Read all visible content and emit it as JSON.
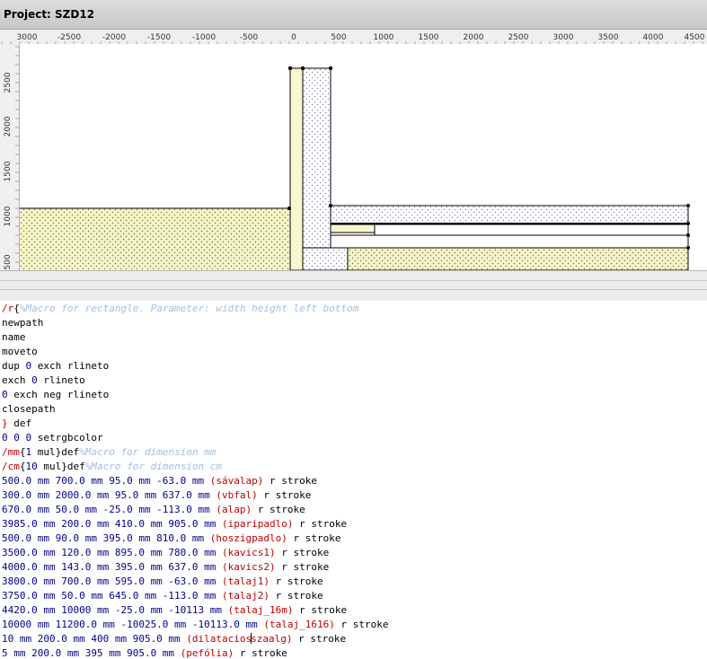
{
  "window": {
    "title": "Project: SZD12"
  },
  "ruler_top": {
    "labels": [
      "3000",
      "-2500",
      "-2000",
      "-1500",
      "-1000",
      "-500",
      "0",
      "500",
      "1000",
      "1500",
      "2000",
      "2500",
      "3000",
      "3500",
      "4000",
      "4500"
    ]
  },
  "ruler_left": {
    "labels": [
      "2500",
      "2000",
      "1500",
      "1000",
      "500"
    ]
  },
  "drawing": {
    "colors": {
      "soil_fill": "#f4f4c8",
      "soil_dots": "#6e7a30",
      "gravel_dots": "#6a6a9a",
      "outline": "#000000"
    }
  },
  "editor": {
    "lines": [
      [
        {
          "t": "/r",
          "c": "red"
        },
        {
          "t": "{",
          "c": "kw"
        },
        {
          "t": "%Macro for rectangle. Parameter: width height left bottom",
          "c": "cmt"
        }
      ],
      [
        {
          "t": "newpath",
          "c": "kw"
        }
      ],
      [
        {
          "t": "name",
          "c": "kw"
        }
      ],
      [
        {
          "t": "moveto",
          "c": "kw"
        }
      ],
      [
        {
          "t": "dup ",
          "c": "kw"
        },
        {
          "t": "0",
          "c": "num"
        },
        {
          "t": " exch rlineto",
          "c": "kw"
        }
      ],
      [
        {
          "t": "exch ",
          "c": "kw"
        },
        {
          "t": "0",
          "c": "num"
        },
        {
          "t": " rlineto",
          "c": "kw"
        }
      ],
      [
        {
          "t": "0",
          "c": "num"
        },
        {
          "t": " exch neg rlineto",
          "c": "kw"
        }
      ],
      [
        {
          "t": "closepath",
          "c": "kw"
        }
      ],
      [
        {
          "t": "}",
          "c": "red"
        },
        {
          "t": " def",
          "c": "kw"
        }
      ],
      [
        {
          "t": "0 0 0",
          "c": "num"
        },
        {
          "t": " setrgbcolor",
          "c": "kw"
        }
      ],
      [
        {
          "t": "/mm",
          "c": "red"
        },
        {
          "t": "{",
          "c": "kw"
        },
        {
          "t": "1",
          "c": "num"
        },
        {
          "t": " mul}def",
          "c": "kw"
        },
        {
          "t": "%Macro for dimension mm",
          "c": "cmt"
        }
      ],
      [
        {
          "t": "/cm",
          "c": "red"
        },
        {
          "t": "{",
          "c": "kw"
        },
        {
          "t": "10",
          "c": "num"
        },
        {
          "t": " mul}def",
          "c": "kw"
        },
        {
          "t": "%Macro for dimension cm",
          "c": "cmt"
        }
      ],
      [
        {
          "t": "500.0 mm 700.0 mm 95.0 mm -63.0 mm ",
          "c": "num"
        },
        {
          "t": "(sávalap)",
          "c": "str"
        },
        {
          "t": " r stroke",
          "c": "kw"
        }
      ],
      [
        {
          "t": "300.0 mm 2000.0 mm 95.0 mm 637.0 mm ",
          "c": "num"
        },
        {
          "t": "(vbfal)",
          "c": "str"
        },
        {
          "t": " r stroke",
          "c": "kw"
        }
      ],
      [
        {
          "t": "670.0 mm 50.0 mm -25.0 mm -113.0 mm ",
          "c": "num"
        },
        {
          "t": "(alap)",
          "c": "str"
        },
        {
          "t": " r stroke",
          "c": "kw"
        }
      ],
      [
        {
          "t": "3985.0 mm 200.0 mm 410.0 mm 905.0 mm ",
          "c": "num"
        },
        {
          "t": "(iparipadlo)",
          "c": "str"
        },
        {
          "t": " r stroke",
          "c": "kw"
        }
      ],
      [
        {
          "t": "500.0 mm 90.0 mm 395.0 mm 810.0 mm ",
          "c": "num"
        },
        {
          "t": "(hoszigpadlo)",
          "c": "str"
        },
        {
          "t": " r stroke",
          "c": "kw"
        }
      ],
      [
        {
          "t": "3500.0 mm 120.0 mm 895.0 mm 780.0 mm ",
          "c": "num"
        },
        {
          "t": "(kavics1)",
          "c": "str"
        },
        {
          "t": " r stroke",
          "c": "kw"
        }
      ],
      [
        {
          "t": "4000.0 mm 143.0 mm 395.0 mm 637.0 mm ",
          "c": "num"
        },
        {
          "t": "(kavics2)",
          "c": "str"
        },
        {
          "t": " r stroke",
          "c": "kw"
        }
      ],
      [
        {
          "t": "3800.0 mm 700.0 mm 595.0 mm -63.0 mm ",
          "c": "num"
        },
        {
          "t": "(talaj1)",
          "c": "str"
        },
        {
          "t": " r stroke",
          "c": "kw"
        }
      ],
      [
        {
          "t": "3750.0 mm 50.0 mm 645.0 mm -113.0 mm ",
          "c": "num"
        },
        {
          "t": "(talaj2)",
          "c": "str"
        },
        {
          "t": " r stroke",
          "c": "kw"
        }
      ],
      [
        {
          "t": "4420.0 mm 10000 mm -25.0 mm -10113 mm ",
          "c": "num"
        },
        {
          "t": "(talaj_16m)",
          "c": "str"
        },
        {
          "t": " r stroke",
          "c": "kw"
        }
      ],
      [
        {
          "t": "10000 mm 11200.0 mm -10025.0 mm -10113.0 mm ",
          "c": "num"
        },
        {
          "t": "(talaj_1616)",
          "c": "str"
        },
        {
          "t": " r stroke",
          "c": "kw"
        }
      ],
      [
        {
          "t": "10 mm 200.0 mm 400 mm 905.0 mm ",
          "c": "num"
        },
        {
          "t": "(dilatacios",
          "c": "str"
        },
        {
          "t": "|",
          "c": "caret"
        },
        {
          "t": "szaalg)",
          "c": "str"
        },
        {
          "t": " r stroke",
          "c": "kw"
        }
      ],
      [
        {
          "t": "5 mm 200.0 mm 395 mm 905.0 mm ",
          "c": "num"
        },
        {
          "t": "(pefólia)",
          "c": "str"
        },
        {
          "t": " r stroke",
          "c": "kw"
        }
      ]
    ]
  }
}
